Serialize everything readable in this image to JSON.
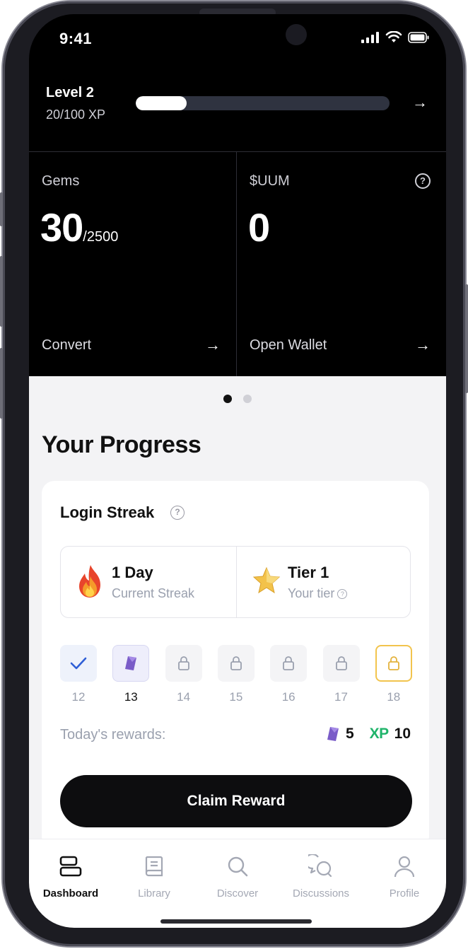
{
  "status": {
    "time": "9:41"
  },
  "level": {
    "label": "Level 2",
    "xp_text": "20/100 XP",
    "progress": 0.2
  },
  "wallet": {
    "gems": {
      "title": "Gems",
      "value": "30",
      "max": "/2500",
      "action": "Convert"
    },
    "uum": {
      "title": "$UUM",
      "value": "0",
      "action": "Open Wallet"
    }
  },
  "pager": {
    "count": 2,
    "active": 0
  },
  "progress": {
    "title": "Your Progress",
    "login_streak": {
      "title": "Login Streak",
      "streak_value": "1 Day",
      "streak_label": "Current Streak",
      "tier_value": "Tier 1",
      "tier_label": "Your tier",
      "days": [
        {
          "num": "12",
          "state": "done",
          "icon": "check-icon"
        },
        {
          "num": "13",
          "state": "current",
          "icon": "gem-icon"
        },
        {
          "num": "14",
          "state": "locked",
          "icon": "lock-icon"
        },
        {
          "num": "15",
          "state": "locked",
          "icon": "lock-icon"
        },
        {
          "num": "16",
          "state": "locked",
          "icon": "lock-icon"
        },
        {
          "num": "17",
          "state": "locked",
          "icon": "lock-icon"
        },
        {
          "num": "18",
          "state": "special",
          "icon": "lock-icon"
        }
      ],
      "rewards_label": "Today's rewards:",
      "gem_reward": "5",
      "xp_tag": "XP",
      "xp_reward": "10",
      "claim_label": "Claim Reward"
    }
  },
  "tabs": [
    {
      "label": "Dashboard",
      "icon": "dashboard-icon",
      "active": true
    },
    {
      "label": "Library",
      "icon": "book-icon",
      "active": false
    },
    {
      "label": "Discover",
      "icon": "search-icon",
      "active": false
    },
    {
      "label": "Discussions",
      "icon": "chat-icon",
      "active": false
    },
    {
      "label": "Profile",
      "icon": "user-icon",
      "active": false
    }
  ],
  "colors": {
    "accent_green": "#1fb46a",
    "gem_purple": "#7a5cc8",
    "special_gold": "#f2c44d"
  }
}
